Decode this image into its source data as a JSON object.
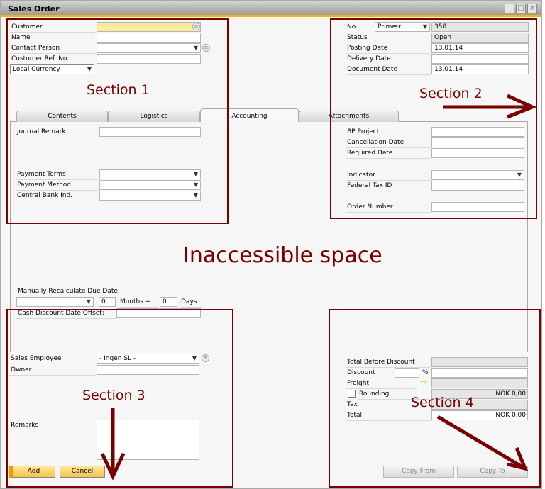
{
  "window": {
    "title": "Sales Order",
    "controls": {
      "minimize": "_",
      "maximize": "□",
      "close": "×"
    }
  },
  "header_left": {
    "customer": {
      "label": "Customer",
      "value": ""
    },
    "name": {
      "label": "Name",
      "value": ""
    },
    "contact_person": {
      "label": "Contact Person",
      "value": ""
    },
    "customer_ref_no": {
      "label": "Customer Ref. No.",
      "value": ""
    },
    "currency": {
      "value": "Local Currency"
    }
  },
  "header_right": {
    "no": {
      "label": "No.",
      "series": "Primær",
      "value": "358"
    },
    "status": {
      "label": "Status",
      "value": "Open"
    },
    "posting_date": {
      "label": "Posting Date",
      "value": "13.01.14"
    },
    "delivery_date": {
      "label": "Delivery Date",
      "value": ""
    },
    "document_date": {
      "label": "Document Date",
      "value": "13.01.14"
    }
  },
  "tabs": [
    {
      "label": "Contents",
      "active": false
    },
    {
      "label": "Logistics",
      "active": false
    },
    {
      "label": "Accounting",
      "active": true
    },
    {
      "label": "Attachments",
      "active": false
    }
  ],
  "accounting_left": {
    "journal_remark": {
      "label": "Journal Remark",
      "value": ""
    },
    "payment_terms": {
      "label": "Payment Terms",
      "value": ""
    },
    "payment_method": {
      "label": "Payment Method",
      "value": ""
    },
    "central_bank_ind": {
      "label": "Central Bank Ind.",
      "value": ""
    },
    "recalc_label": "Manually Recalculate Due Date:",
    "recalc_select": "",
    "months_value": "0",
    "months_label": "Months +",
    "days_value": "0",
    "days_label": "Days",
    "cash_discount": {
      "label": "Cash Discount Date Offset:",
      "value": ""
    }
  },
  "accounting_right": {
    "bp_project": {
      "label": "BP Project",
      "value": ""
    },
    "cancellation_date": {
      "label": "Cancellation Date",
      "value": ""
    },
    "required_date": {
      "label": "Required Date",
      "value": ""
    },
    "indicator": {
      "label": "Indicator",
      "value": ""
    },
    "federal_tax_id": {
      "label": "Federal Tax ID",
      "value": ""
    },
    "order_number": {
      "label": "Order Number",
      "value": ""
    }
  },
  "footer_left": {
    "sales_employee": {
      "label": "Sales Employee",
      "value": "- Ingen SL -"
    },
    "owner": {
      "label": "Owner",
      "value": ""
    },
    "remarks": {
      "label": "Remarks",
      "value": ""
    },
    "add_button": "Add",
    "cancel_button": "Cancel"
  },
  "footer_right": {
    "total_before_discount": {
      "label": "Total Before Discount",
      "value": ""
    },
    "discount": {
      "label": "Discount",
      "percent": "",
      "percent_sign": "%",
      "value": ""
    },
    "freight": {
      "label": "Freight",
      "value": ""
    },
    "rounding": {
      "label": "Rounding",
      "checked": false,
      "value": "NOK 0,00"
    },
    "tax": {
      "label": "Tax",
      "value": ""
    },
    "total": {
      "label": "Total",
      "value": "NOK 0,00"
    },
    "copy_from_button": "Copy From",
    "copy_to_button": "Copy To"
  },
  "annotations": {
    "section1": "Section 1",
    "section2": "Section 2",
    "section3": "Section 3",
    "section4": "Section 4",
    "inaccessible": "Inaccessible space",
    "color": "#7a0000"
  }
}
